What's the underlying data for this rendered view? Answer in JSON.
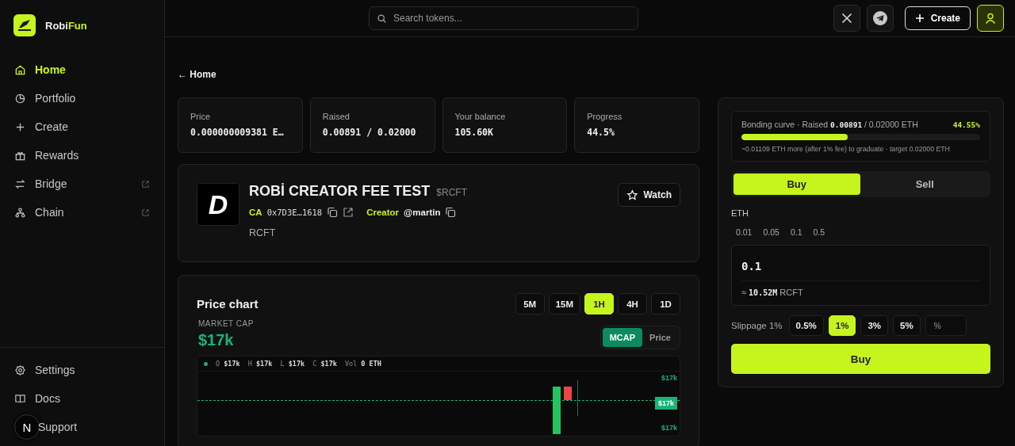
{
  "brand": {
    "part_1": "Robi",
    "part_2": "Fun"
  },
  "sidebar": {
    "items": [
      {
        "label": "Home",
        "selected": true,
        "external": false
      },
      {
        "label": "Portfolio",
        "selected": false,
        "external": false
      },
      {
        "label": "Create",
        "selected": false,
        "external": false
      },
      {
        "label": "Rewards",
        "selected": false,
        "external": false
      },
      {
        "label": "Bridge",
        "selected": false,
        "external": true
      },
      {
        "label": "Chain",
        "selected": false,
        "external": true
      }
    ],
    "footer_items": [
      {
        "label": "Settings"
      },
      {
        "label": "Docs"
      },
      {
        "label": "Support"
      }
    ],
    "dev_badge": "N"
  },
  "topbar": {
    "search": {
      "placeholder": "Search tokens..."
    },
    "create_button": "Create"
  },
  "back_link": "← Home",
  "stats": [
    {
      "label": "Price",
      "value": "0.000000009381 E…"
    },
    {
      "label": "Raised",
      "value": "0.00891 / 0.02000"
    },
    {
      "label": "Your balance",
      "value": "105.60K"
    },
    {
      "label": "Progress",
      "value": "44.5%"
    }
  ],
  "token": {
    "logo_text": "D",
    "name": "ROBİ CREATOR FEE TEST",
    "ticker": "$RCFT",
    "ca_label": "CA",
    "ca": "0x7D3E…1618",
    "creator_label": "Creator",
    "creator": "@martin",
    "description": "RCFT",
    "watch_button": "Watch"
  },
  "chart_card": {
    "title": "Price chart",
    "timeframes": [
      {
        "label": "5M",
        "selected": false
      },
      {
        "label": "15M",
        "selected": false
      },
      {
        "label": "1H",
        "selected": true
      },
      {
        "label": "4H",
        "selected": false
      },
      {
        "label": "1D",
        "selected": false
      }
    ],
    "metric_label": "MARKET CAP",
    "metric_value": "$17k",
    "modes": [
      {
        "label": "MCAP",
        "selected": true
      },
      {
        "label": "Price",
        "selected": false
      }
    ],
    "ohlc": [
      {
        "key": "O",
        "value": "$17k"
      },
      {
        "key": "H",
        "value": "$17k"
      },
      {
        "key": "L",
        "value": "$17k"
      },
      {
        "key": "C",
        "value": "$17k"
      },
      {
        "key": "Vol",
        "value": "0 ETH"
      }
    ],
    "axis_labels": [
      {
        "label": "$17k",
        "current": false
      },
      {
        "label": "$17k",
        "current": true
      },
      {
        "label": "$17k",
        "current": false
      }
    ]
  },
  "trade": {
    "bonding": {
      "text": "Bonding curve · Raised **0.00891** / 0.02000 ETH",
      "percent": "44.55%",
      "level": 0.4455,
      "note": "~0.01109 ETH more (after 1% fee) to graduate · target 0.02000 ETH"
    },
    "tabs": [
      {
        "label": "Buy",
        "selected": true
      },
      {
        "label": "Sell",
        "selected": false
      }
    ],
    "currency": "ETH",
    "presets": [
      "0.01",
      "0.05",
      "0.1",
      "0.5"
    ],
    "amount": "0.1",
    "estimate": "≈ **10.52M** RCFT",
    "slippage_label": "Slippage 1%",
    "slippage_options": [
      {
        "label": "0.5%",
        "selected": false
      },
      {
        "label": "1%",
        "selected": true
      },
      {
        "label": "3%",
        "selected": false
      },
      {
        "label": "5%",
        "selected": false
      }
    ],
    "custom_slippage": {
      "placeholder": "%"
    },
    "submit": "Buy"
  }
}
